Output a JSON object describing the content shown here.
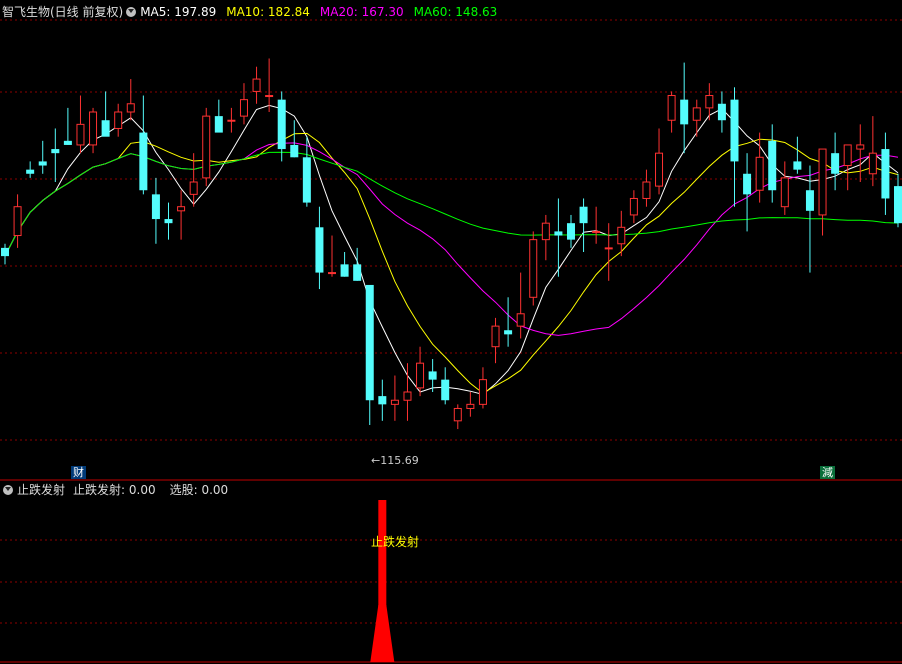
{
  "main_panel": {
    "stock_title": "智飞生物(日线 前复权)",
    "ma_legend": [
      {
        "label": "MA5: 197.89",
        "color": "#ffffff"
      },
      {
        "label": "MA10: 182.84",
        "color": "#ffff00"
      },
      {
        "label": "MA20: 167.30",
        "color": "#ff00ff"
      },
      {
        "label": "MA60: 148.63",
        "color": "#00ff00"
      }
    ],
    "low_label": "←115.69",
    "marker_left": "财",
    "marker_right": "減"
  },
  "indicator_panel": {
    "name": "止跌发射",
    "values": [
      {
        "label": "止跌发射: 0.00"
      },
      {
        "label": "选股: 0.00"
      }
    ],
    "signal_label": "止跌发射"
  },
  "colors": {
    "up": "#ff3232",
    "down": "#54fcfc",
    "ma5": "#ffffff",
    "ma10": "#ffff00",
    "ma20": "#ff00ff",
    "ma60": "#00ff00",
    "grid": "#8b0000",
    "signal": "#ff0000"
  },
  "chart_data": {
    "type": "candlestick",
    "candles": [
      [
        162,
        163,
        158,
        160
      ],
      [
        165,
        175,
        162,
        172
      ],
      [
        181,
        183,
        179,
        180
      ],
      [
        183,
        188,
        180,
        182
      ],
      [
        186,
        191,
        178,
        185
      ],
      [
        188,
        196,
        187,
        187
      ],
      [
        187,
        199,
        185,
        192
      ],
      [
        187,
        196,
        185,
        195
      ],
      [
        193,
        200,
        190,
        189
      ],
      [
        191,
        197,
        189,
        195
      ],
      [
        195,
        203,
        193,
        197
      ],
      [
        190,
        199,
        175,
        176
      ],
      [
        175,
        179,
        163,
        169
      ],
      [
        169,
        173,
        164,
        168
      ],
      [
        171,
        176,
        164,
        172
      ],
      [
        175,
        185,
        172,
        178
      ],
      [
        179,
        196,
        177,
        194
      ],
      [
        194,
        198,
        193,
        190
      ],
      [
        193,
        196,
        190,
        193
      ],
      [
        194,
        202,
        192,
        198
      ],
      [
        200,
        206,
        197,
        203
      ],
      [
        199,
        208,
        195,
        199
      ],
      [
        198,
        200,
        183,
        186
      ],
      [
        187,
        193,
        184,
        184
      ],
      [
        184,
        189,
        172,
        173
      ],
      [
        167,
        172,
        152,
        156
      ],
      [
        156,
        165,
        155,
        156
      ],
      [
        158,
        161,
        155,
        155
      ],
      [
        158,
        162,
        154,
        154
      ],
      [
        153,
        153,
        119,
        125
      ],
      [
        126,
        130,
        120,
        124
      ],
      [
        124,
        131,
        120,
        125
      ],
      [
        125,
        134,
        120,
        127
      ],
      [
        128,
        138,
        126,
        134
      ],
      [
        132,
        135,
        127,
        130
      ],
      [
        130,
        133,
        124,
        125
      ],
      [
        120,
        124,
        118,
        123
      ],
      [
        123,
        127,
        121,
        124
      ],
      [
        124,
        133,
        123,
        130
      ],
      [
        138,
        145,
        134,
        143
      ],
      [
        142,
        150,
        138,
        141
      ],
      [
        143,
        156,
        140,
        146
      ],
      [
        150,
        166,
        148,
        164
      ],
      [
        164,
        170,
        159,
        168
      ],
      [
        166,
        174,
        155,
        165
      ],
      [
        168,
        170,
        162,
        164
      ],
      [
        172,
        174,
        161,
        168
      ],
      [
        166,
        172,
        163,
        166
      ],
      [
        162,
        168,
        154,
        162
      ],
      [
        163,
        171,
        160,
        167
      ],
      [
        170,
        176,
        168,
        174
      ],
      [
        174,
        181,
        172,
        178
      ],
      [
        177,
        191,
        175,
        185
      ],
      [
        193,
        200,
        190,
        199
      ],
      [
        198,
        207,
        185,
        192
      ],
      [
        193,
        198,
        189,
        196
      ],
      [
        196,
        202,
        193,
        199
      ],
      [
        197,
        200,
        190,
        193
      ],
      [
        198,
        201,
        172,
        183
      ],
      [
        180,
        185,
        166,
        175
      ],
      [
        176,
        190,
        173,
        184
      ],
      [
        188,
        192,
        173,
        176
      ],
      [
        172,
        183,
        170,
        179
      ],
      [
        183,
        189,
        180,
        181
      ],
      [
        176,
        182,
        156,
        171
      ],
      [
        170,
        184,
        165,
        186
      ],
      [
        185,
        190,
        176,
        180
      ],
      [
        182,
        185,
        176,
        187
      ],
      [
        186,
        192,
        178,
        187
      ],
      [
        180,
        194,
        177,
        185
      ],
      [
        186,
        190,
        170,
        174
      ],
      [
        177,
        180,
        167,
        168
      ]
    ],
    "ma5_last": 197.89,
    "ma10_last": 182.84,
    "ma20_last": 167.3,
    "ma60_last": 148.63,
    "low_point": 115.69,
    "signal": {
      "label": "止跌发射",
      "position": "bar 30"
    }
  }
}
